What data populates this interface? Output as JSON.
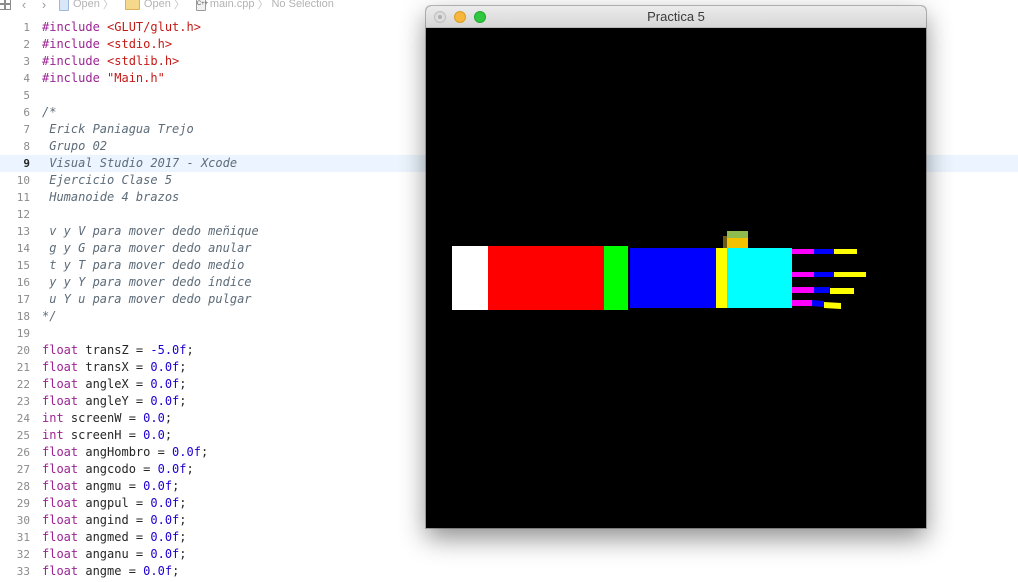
{
  "jumpbar": {
    "crumbs": [
      "Open",
      "Open",
      "main.cpp",
      "No Selection"
    ],
    "file_icon_text": "C++"
  },
  "editor": {
    "current_line": 9,
    "lines": [
      {
        "n": "1",
        "tokens": [
          {
            "t": "#include ",
            "c": "kw"
          },
          {
            "t": "<GLUT/glut.h>",
            "c": "str"
          }
        ]
      },
      {
        "n": "2",
        "tokens": [
          {
            "t": "#include ",
            "c": "kw"
          },
          {
            "t": "<stdio.h>",
            "c": "str"
          }
        ]
      },
      {
        "n": "3",
        "tokens": [
          {
            "t": "#include ",
            "c": "kw"
          },
          {
            "t": "<stdlib.h>",
            "c": "str"
          }
        ]
      },
      {
        "n": "4",
        "tokens": [
          {
            "t": "#include ",
            "c": "kw"
          },
          {
            "t": "\"Main.h\"",
            "c": "str"
          }
        ]
      },
      {
        "n": "5",
        "tokens": []
      },
      {
        "n": "6",
        "tokens": [
          {
            "t": "/*",
            "c": "cm"
          }
        ]
      },
      {
        "n": "7",
        "tokens": [
          {
            "t": " Erick Paniagua Trejo",
            "c": "cm"
          }
        ]
      },
      {
        "n": "8",
        "tokens": [
          {
            "t": " Grupo 02",
            "c": "cm"
          }
        ]
      },
      {
        "n": "9",
        "tokens": [
          {
            "t": " Visual Studio 2017 - Xcode",
            "c": "cm"
          }
        ]
      },
      {
        "n": "10",
        "tokens": [
          {
            "t": " Ejercicio Clase 5",
            "c": "cm"
          }
        ]
      },
      {
        "n": "11",
        "tokens": [
          {
            "t": " Humanoide 4 brazos",
            "c": "cm"
          }
        ]
      },
      {
        "n": "12",
        "tokens": []
      },
      {
        "n": "13",
        "tokens": [
          {
            "t": " v y V para mover dedo meñique",
            "c": "cm"
          }
        ]
      },
      {
        "n": "14",
        "tokens": [
          {
            "t": " g y G para mover dedo anular",
            "c": "cm"
          }
        ]
      },
      {
        "n": "15",
        "tokens": [
          {
            "t": " t y T para mover dedo medio",
            "c": "cm"
          }
        ]
      },
      {
        "n": "16",
        "tokens": [
          {
            "t": " y y Y para mover dedo índice",
            "c": "cm"
          }
        ]
      },
      {
        "n": "17",
        "tokens": [
          {
            "t": " u Y u para mover dedo pulgar",
            "c": "cm"
          }
        ]
      },
      {
        "n": "18",
        "tokens": [
          {
            "t": "*/",
            "c": "cm"
          }
        ]
      },
      {
        "n": "19",
        "tokens": []
      },
      {
        "n": "20",
        "tokens": [
          {
            "t": "float",
            "c": "kw"
          },
          {
            "t": " transZ = ",
            "c": ""
          },
          {
            "t": "-5.0f",
            "c": "num"
          },
          {
            "t": ";",
            "c": ""
          }
        ]
      },
      {
        "n": "21",
        "tokens": [
          {
            "t": "float",
            "c": "kw"
          },
          {
            "t": " transX = ",
            "c": ""
          },
          {
            "t": "0.0f",
            "c": "num"
          },
          {
            "t": ";",
            "c": ""
          }
        ]
      },
      {
        "n": "22",
        "tokens": [
          {
            "t": "float",
            "c": "kw"
          },
          {
            "t": " angleX = ",
            "c": ""
          },
          {
            "t": "0.0f",
            "c": "num"
          },
          {
            "t": ";",
            "c": ""
          }
        ]
      },
      {
        "n": "23",
        "tokens": [
          {
            "t": "float",
            "c": "kw"
          },
          {
            "t": " angleY = ",
            "c": ""
          },
          {
            "t": "0.0f",
            "c": "num"
          },
          {
            "t": ";",
            "c": ""
          }
        ]
      },
      {
        "n": "24",
        "tokens": [
          {
            "t": "int",
            "c": "kw"
          },
          {
            "t": " screenW = ",
            "c": ""
          },
          {
            "t": "0.0",
            "c": "num"
          },
          {
            "t": ";",
            "c": ""
          }
        ]
      },
      {
        "n": "25",
        "tokens": [
          {
            "t": "int",
            "c": "kw"
          },
          {
            "t": " screenH = ",
            "c": ""
          },
          {
            "t": "0.0",
            "c": "num"
          },
          {
            "t": ";",
            "c": ""
          }
        ]
      },
      {
        "n": "26",
        "tokens": [
          {
            "t": "float",
            "c": "kw"
          },
          {
            "t": " angHombro = ",
            "c": ""
          },
          {
            "t": "0.0f",
            "c": "num"
          },
          {
            "t": ";",
            "c": ""
          }
        ]
      },
      {
        "n": "27",
        "tokens": [
          {
            "t": "float",
            "c": "kw"
          },
          {
            "t": " angcodo = ",
            "c": ""
          },
          {
            "t": "0.0f",
            "c": "num"
          },
          {
            "t": ";",
            "c": ""
          }
        ]
      },
      {
        "n": "28",
        "tokens": [
          {
            "t": "float",
            "c": "kw"
          },
          {
            "t": " angmu = ",
            "c": ""
          },
          {
            "t": "0.0f",
            "c": "num"
          },
          {
            "t": ";",
            "c": ""
          }
        ]
      },
      {
        "n": "29",
        "tokens": [
          {
            "t": "float",
            "c": "kw"
          },
          {
            "t": " angpul = ",
            "c": ""
          },
          {
            "t": "0.0f",
            "c": "num"
          },
          {
            "t": ";",
            "c": ""
          }
        ]
      },
      {
        "n": "30",
        "tokens": [
          {
            "t": "float",
            "c": "kw"
          },
          {
            "t": " angind = ",
            "c": ""
          },
          {
            "t": "0.0f",
            "c": "num"
          },
          {
            "t": ";",
            "c": ""
          }
        ]
      },
      {
        "n": "31",
        "tokens": [
          {
            "t": "float",
            "c": "kw"
          },
          {
            "t": " angmed = ",
            "c": ""
          },
          {
            "t": "0.0f",
            "c": "num"
          },
          {
            "t": ";",
            "c": ""
          }
        ]
      },
      {
        "n": "32",
        "tokens": [
          {
            "t": "float",
            "c": "kw"
          },
          {
            "t": " anganu = ",
            "c": ""
          },
          {
            "t": "0.0f",
            "c": "num"
          },
          {
            "t": ";",
            "c": ""
          }
        ]
      },
      {
        "n": "33",
        "tokens": [
          {
            "t": "float",
            "c": "kw"
          },
          {
            "t": " angme = ",
            "c": ""
          },
          {
            "t": "0.0f",
            "c": "num"
          },
          {
            "t": ";",
            "c": ""
          }
        ]
      }
    ]
  },
  "gl_window": {
    "title": "Practica 5",
    "colors": {
      "background": "#000000",
      "white": "#ffffff",
      "red": "#ff0000",
      "green": "#00ff00",
      "blue": "#0000ff",
      "yellow": "#ffff00",
      "cyan": "#00ffff",
      "magenta": "#ff00ff",
      "thumb_top": "#8fbc4f",
      "thumb_mid": "#f2c200"
    }
  },
  "colors": {
    "keyword": "#9b2393",
    "string": "#c41a16",
    "number": "#1c00cf",
    "comment": "#5d6c79",
    "current_line_bg": "#ecf5ff"
  }
}
